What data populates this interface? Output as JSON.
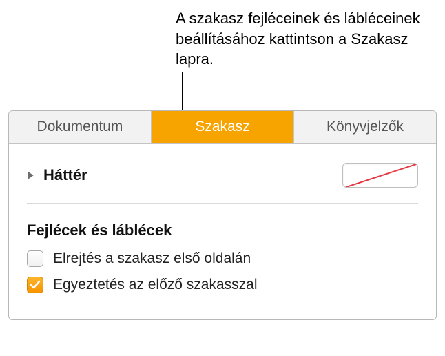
{
  "callout": "A szakasz fejléceinek és lábléceinek beállításához kattintson a Szakasz lapra.",
  "tabs": {
    "document": "Dokumentum",
    "section": "Szakasz",
    "bookmarks": "Könyvjelzők"
  },
  "background": {
    "label": "Háttér"
  },
  "headersFooters": {
    "title": "Fejlécek és láblécek",
    "hideFirstPage": {
      "label": "Elrejtés a szakasz első oldalán",
      "checked": false
    },
    "matchPrevious": {
      "label": "Egyeztetés az előző szakasszal",
      "checked": true
    }
  }
}
